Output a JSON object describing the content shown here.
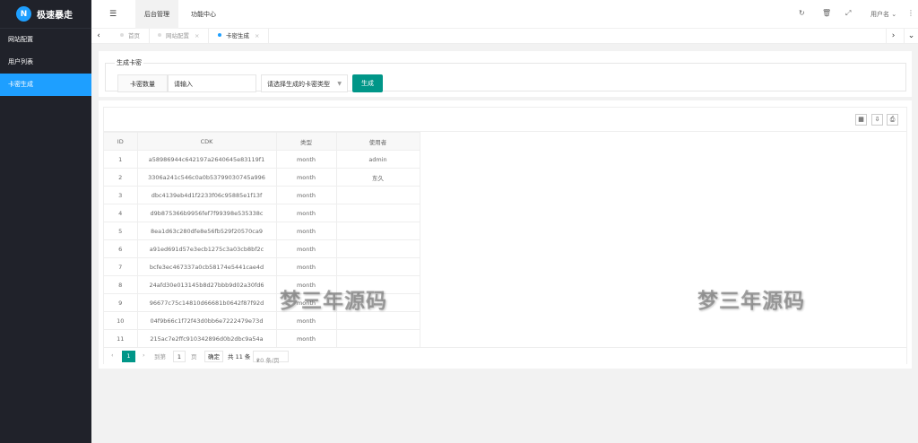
{
  "app": {
    "logo_text": "极速暴走",
    "logo_mark": "N"
  },
  "sidebar": {
    "items": [
      {
        "label": "网站配置"
      },
      {
        "label": "用户列表"
      },
      {
        "label": "卡密生成"
      }
    ]
  },
  "header": {
    "tabs": [
      {
        "label": "后台管理"
      },
      {
        "label": "功能中心"
      }
    ],
    "user_label": "用户名"
  },
  "page_tabs": [
    {
      "label": "首页"
    },
    {
      "label": "网站配置"
    },
    {
      "label": "卡密生成"
    }
  ],
  "form": {
    "legend": "生成卡密",
    "qty_label": "卡密数量",
    "qty_placeholder": "请输入",
    "type_placeholder": "请选择生成的卡密类型",
    "generate_label": "生成"
  },
  "table": {
    "columns": [
      "ID",
      "CDK",
      "类型",
      "使用者"
    ],
    "rows": [
      [
        "1",
        "a58986944c642197a2640645e83119f1",
        "month",
        "admin"
      ],
      [
        "2",
        "3306a241c546c0a0b53799030745a996",
        "month",
        "东久"
      ],
      [
        "3",
        "dbc4139eb4d1f2233f06c95885e1f13f",
        "month",
        ""
      ],
      [
        "4",
        "d9b875366b9956fef7f99398e535338c",
        "month",
        ""
      ],
      [
        "5",
        "8ea1d63c280dfe8e56fb529f20570ca9",
        "month",
        ""
      ],
      [
        "6",
        "a91ed691d57e3ecb1275c3a03cb8bf2c",
        "month",
        ""
      ],
      [
        "7",
        "bcfe3ec467337a0cb58174e5441cae4d",
        "month",
        ""
      ],
      [
        "8",
        "24afd30e013145b8d27bbb9d02a30fd6",
        "month",
        ""
      ],
      [
        "9",
        "96677c75c14810d66681b0642f87f92d",
        "month",
        ""
      ],
      [
        "10",
        "04f9b66c1f72f43d0bb6e7222479e73d",
        "month",
        ""
      ],
      [
        "11",
        "215ac7e2ffc910342896d0b2dbc9a54a",
        "month",
        ""
      ]
    ]
  },
  "pager": {
    "current": "1",
    "goto_label": "到第",
    "page_input": "1",
    "page_unit": "页",
    "confirm": "确定",
    "total": "共 11 条",
    "page_size": "20 条/页"
  },
  "watermark": "梦三年源码"
}
